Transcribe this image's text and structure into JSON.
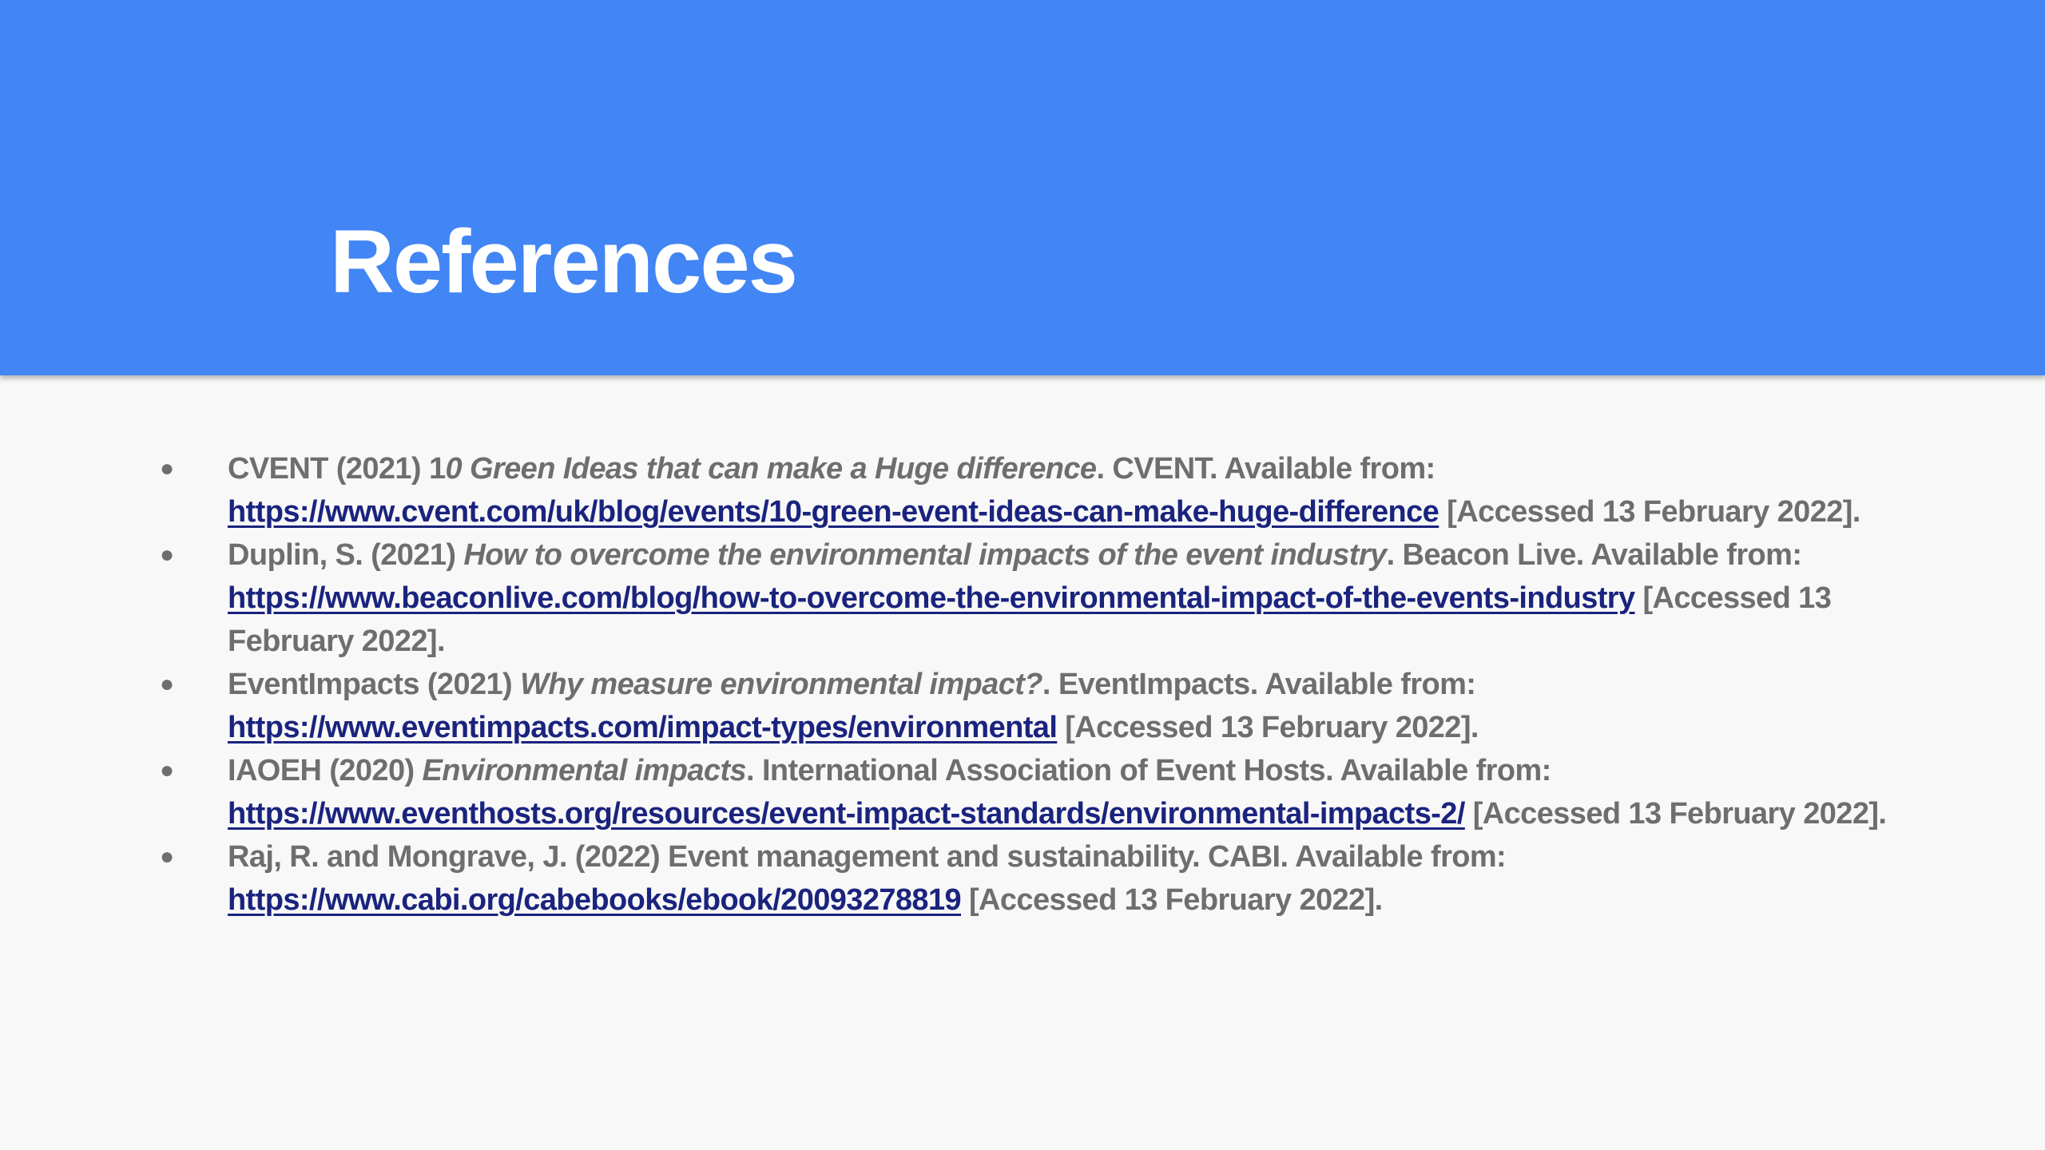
{
  "slide": {
    "title": "References",
    "header_color": "#4285f4",
    "link_color": "#1a237e"
  },
  "references": [
    {
      "bullet": "●",
      "prefix": "CVENT (2021) 1",
      "italic": "0 Green Ideas that can make a Huge difference",
      "suffix": ". CVENT. Available from: ",
      "url": "https://www.cvent.com/uk/blog/events/10-green-event-ideas-can-make-huge-difference",
      "accessed": " [Accessed 13 February 2022]."
    },
    {
      "bullet": "●",
      "prefix": "Duplin, S. (2021) ",
      "italic": "How to overcome the environmental impacts of the event industry",
      "suffix": ". Beacon Live. Available from: ",
      "url": "https://www.beaconlive.com/blog/how-to-overcome-the-environmental-impact-of-the-events-industry",
      "accessed": " [Accessed 13 February 2022]."
    },
    {
      "bullet": "●",
      "prefix": "EventImpacts (2021) ",
      "italic": "Why measure environmental impact?",
      "suffix": ". EventImpacts. Available from: ",
      "url": "https://www.eventimpacts.com/impact-types/environmental",
      "accessed": " [Accessed 13 February 2022]."
    },
    {
      "bullet": "●",
      "prefix": "IAOEH (2020) ",
      "italic": "Environmental impacts",
      "suffix": ". International Association of Event Hosts. Available from: ",
      "url": "https://www.eventhosts.org/resources/event-impact-standards/environmental-impacts-2/",
      "accessed": " [Accessed 13 February 2022]."
    },
    {
      "bullet": "●",
      "prefix": "Raj, R. and Mongrave, J. (2022) Event management and sustainability. CABI. Available from: ",
      "italic": "",
      "suffix": "",
      "url": "https://www.cabi.org/cabebooks/ebook/20093278819",
      "accessed": " [Accessed 13 February 2022]."
    }
  ]
}
